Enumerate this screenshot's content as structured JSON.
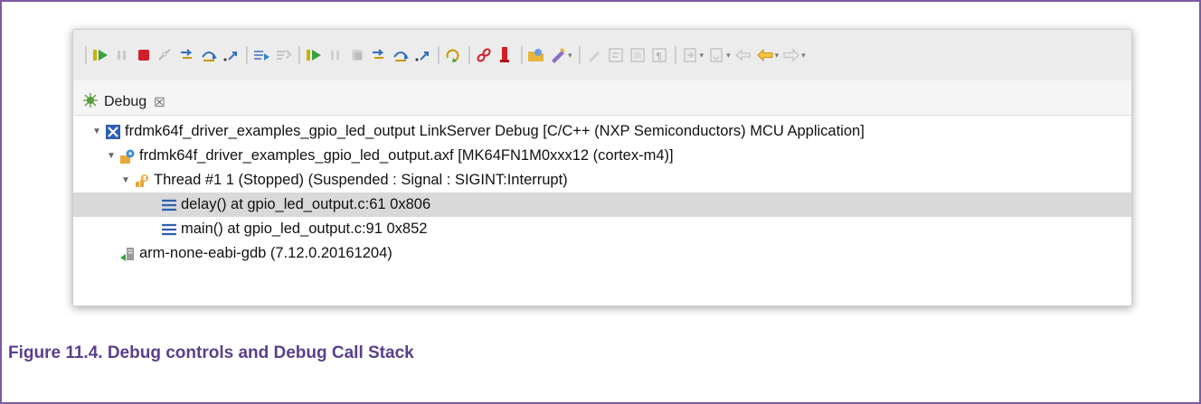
{
  "debug_view": {
    "tab_label": "Debug",
    "tab_close": "☒",
    "tree": [
      {
        "label": "frdmk64f_driver_examples_gpio_led_output LinkServer Debug [C/C++ (NXP Semiconductors) MCU Application]",
        "icon": "launch-config-icon",
        "expanded": true
      },
      {
        "label": "frdmk64f_driver_examples_gpio_led_output.axf [MK64FN1M0xxx12 (cortex-m4)]",
        "icon": "debug-target-icon",
        "expanded": true
      },
      {
        "label": "Thread #1 1 (Stopped) (Suspended : Signal : SIGINT:Interrupt)",
        "icon": "thread-icon",
        "expanded": true
      },
      {
        "label": "delay() at gpio_led_output.c:61 0x806",
        "icon": "stack-frame-icon",
        "selected": true
      },
      {
        "label": "main() at gpio_led_output.c:91 0x852",
        "icon": "stack-frame-icon"
      },
      {
        "label": "arm-none-eabi-gdb (7.12.0.20161204)",
        "icon": "gdb-process-icon"
      }
    ]
  },
  "toolbar": {
    "icons": [
      "resume-icon",
      "suspend-icon",
      "terminate-icon",
      "disconnect-icon",
      "step-into-icon",
      "step-over-icon",
      "step-return-icon",
      "instruction-stepping-icon",
      "drop-to-frame-icon",
      "resume-all-icon",
      "suspend-all-icon",
      "terminate-all-icon",
      "step-into-all-icon",
      "step-over-all-icon",
      "step-return-all-icon",
      "restart-icon",
      "link-icon",
      "magnet-icon",
      "open-folder-icon",
      "pen-icon",
      "edit-icon",
      "properties-icon",
      "grid-icon",
      "pilcrow-icon",
      "annotation-icon",
      "next-annotation-icon",
      "last-edit-icon",
      "back-icon",
      "forward-icon"
    ]
  },
  "caption": "Figure 11.4. Debug controls and Debug Call Stack",
  "colors": {
    "caption": "#5b3f8c",
    "frame_border": "#7d5aa0",
    "selection": "#d9d9d9"
  }
}
